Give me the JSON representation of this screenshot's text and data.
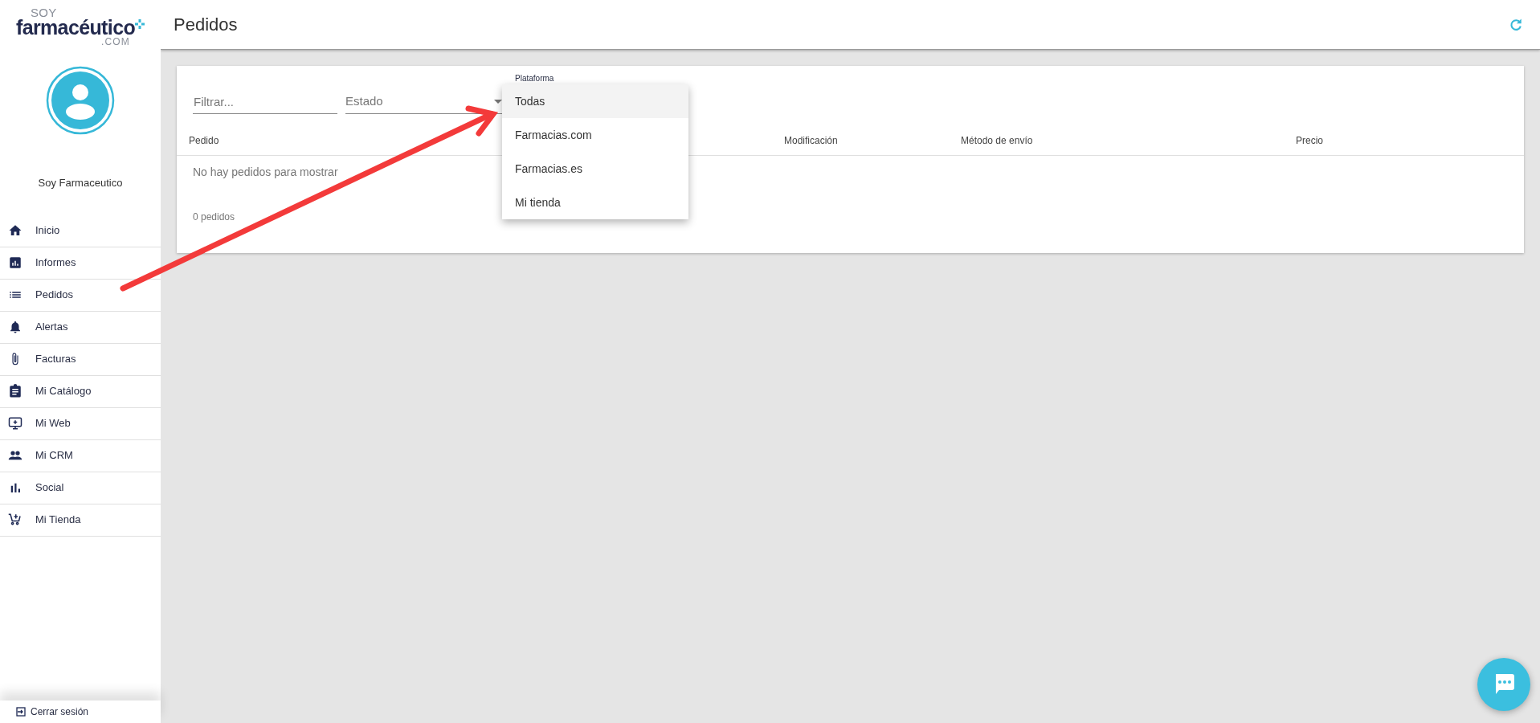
{
  "logo": {
    "top": "SOY",
    "main": "farmacéutico",
    "suffix": ".COM"
  },
  "header": {
    "title": "Pedidos"
  },
  "user": {
    "name": "Soy Farmaceutico"
  },
  "sidebar": {
    "items": [
      {
        "label": "Inicio",
        "selected": false
      },
      {
        "label": "Informes",
        "selected": false
      },
      {
        "label": "Pedidos",
        "selected": false
      },
      {
        "label": "Alertas",
        "selected": false
      },
      {
        "label": "Facturas",
        "selected": false
      },
      {
        "label": "Mi Catálogo",
        "selected": false
      },
      {
        "label": "Mi Web",
        "selected": false
      },
      {
        "label": "Mi CRM",
        "selected": false
      },
      {
        "label": "Social",
        "selected": false
      },
      {
        "label": "Mi Tienda",
        "selected": false
      }
    ],
    "logout": "Cerrar sesión"
  },
  "filters": {
    "search": {
      "placeholder": "Filtrar..."
    },
    "status": {
      "placeholder": "Estado"
    },
    "platform": {
      "label": "Plataforma",
      "options": [
        {
          "label": "Todas",
          "selected": true
        },
        {
          "label": "Farmacias.com",
          "selected": false
        },
        {
          "label": "Farmacias.es",
          "selected": false
        },
        {
          "label": "Mi tienda",
          "selected": false
        }
      ]
    }
  },
  "table": {
    "columns": [
      "Pedido",
      "Modificación",
      "Método de envío",
      "Precio"
    ],
    "empty_message": "No hay pedidos para mostrar",
    "count": "0 pedidos"
  }
}
